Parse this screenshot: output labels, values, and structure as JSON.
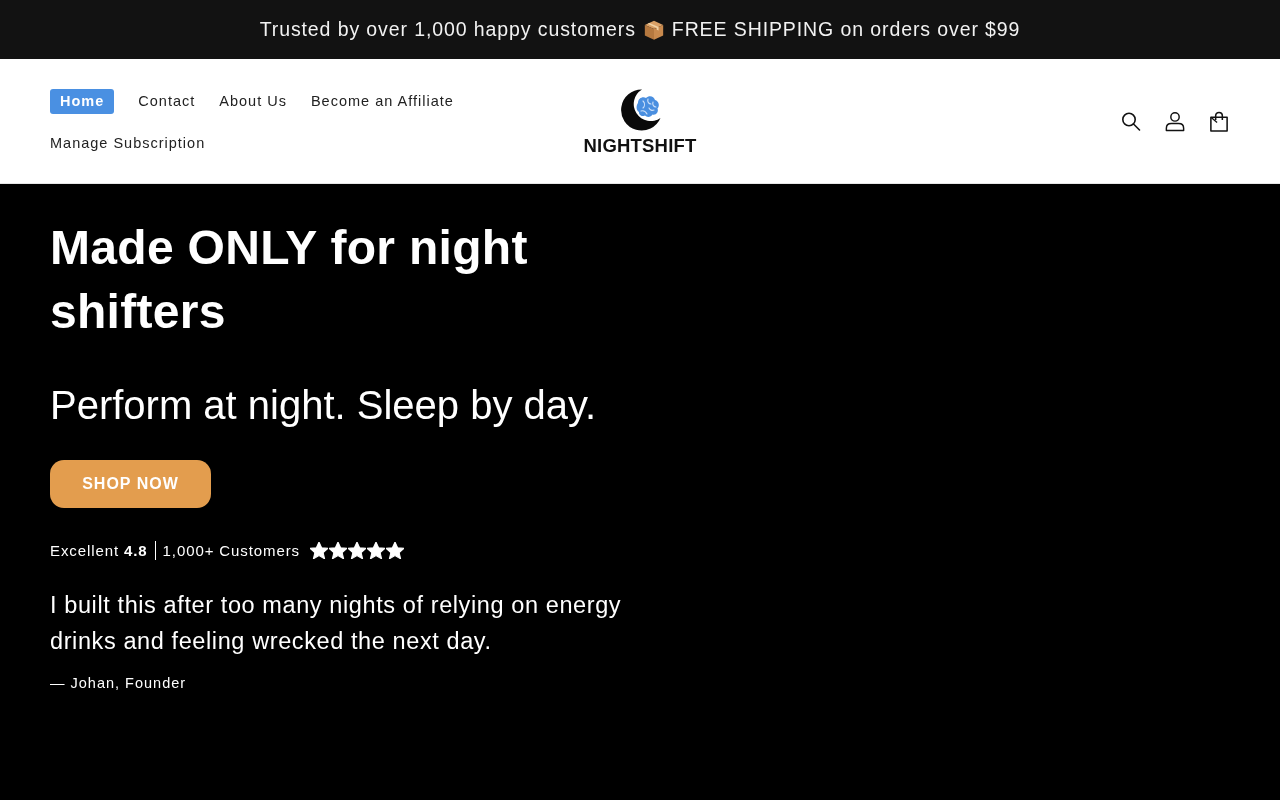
{
  "announcement": {
    "text_before": "Trusted by over 1,000 happy customers",
    "text_after": "FREE SHIPPING on orders over $99"
  },
  "nav": {
    "items": [
      {
        "label": "Home",
        "selected": true
      },
      {
        "label": "Contact",
        "selected": false
      },
      {
        "label": "About Us",
        "selected": false
      },
      {
        "label": "Become an Affiliate",
        "selected": false
      },
      {
        "label": "Manage Subscription",
        "selected": false
      }
    ]
  },
  "logo": {
    "text": "NIGHTSHIFT"
  },
  "hero": {
    "heading": "Made ONLY for night shifters",
    "subheading": "Perform at night. Sleep by day.",
    "button": "SHOP NOW",
    "rating": {
      "label": "Excellent **4.8**",
      "customers": "1,000+ Customers",
      "stars": 5
    },
    "quote": "I built this after too many nights of relying on energy drinks and feeling wrecked the next day.",
    "attribution": "— Johan, Founder"
  }
}
